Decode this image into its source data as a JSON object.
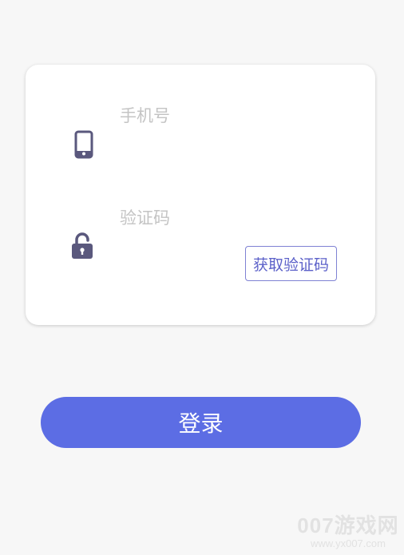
{
  "login_form": {
    "phone_placeholder": "手机号",
    "phone_value": "",
    "phone_icon": "mobile-phone-icon",
    "code_placeholder": "验证码",
    "code_value": "",
    "code_icon": "unlock-icon",
    "get_code_label": "获取验证码"
  },
  "login_button_label": "登录",
  "watermark": {
    "text": "007游戏网",
    "url": "www.yx007.com"
  },
  "colors": {
    "background": "#f7f7f7",
    "card": "#ffffff",
    "icon": "#5a587d",
    "accent": "#5c6de4",
    "placeholder": "#c4c4c4"
  }
}
